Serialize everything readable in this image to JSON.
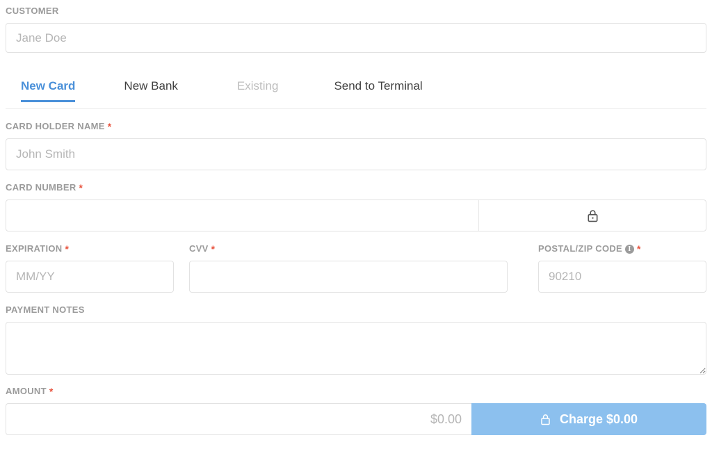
{
  "customer": {
    "label": "CUSTOMER",
    "placeholder": "Jane Doe",
    "value": ""
  },
  "tabs": [
    {
      "label": "New Card",
      "state": "active"
    },
    {
      "label": "New Bank",
      "state": "enabled"
    },
    {
      "label": "Existing",
      "state": "disabled"
    },
    {
      "label": "Send to Terminal",
      "state": "enabled"
    }
  ],
  "card_holder": {
    "label": "CARD HOLDER NAME",
    "required": "*",
    "placeholder": "John Smith",
    "value": ""
  },
  "card_number": {
    "label": "CARD NUMBER",
    "required": "*",
    "placeholder": "",
    "value": "",
    "lock_icon": "lock-icon"
  },
  "expiration": {
    "label": "EXPIRATION",
    "required": "*",
    "placeholder": "MM/YY",
    "value": ""
  },
  "cvv": {
    "label": "CVV",
    "required": "*",
    "placeholder": "",
    "value": ""
  },
  "postal": {
    "label": "POSTAL/ZIP CODE",
    "required": "*",
    "info_icon": "info-icon",
    "info_glyph": "i",
    "placeholder": "90210",
    "value": ""
  },
  "payment_notes": {
    "label": "PAYMENT NOTES",
    "placeholder": "",
    "value": ""
  },
  "amount": {
    "label": "AMOUNT",
    "required": "*",
    "placeholder": "$0.00",
    "value": ""
  },
  "charge_button": {
    "label": "Charge $0.00",
    "lock_icon": "lock-icon",
    "color": "#8cc0ee",
    "enabled": false
  },
  "colors": {
    "accent": "#4a90d9",
    "required": "#e8543f",
    "label": "#9b9b9b",
    "border": "#e2e2e2",
    "placeholder": "#b6b6b6",
    "button": "#8cc0ee"
  }
}
